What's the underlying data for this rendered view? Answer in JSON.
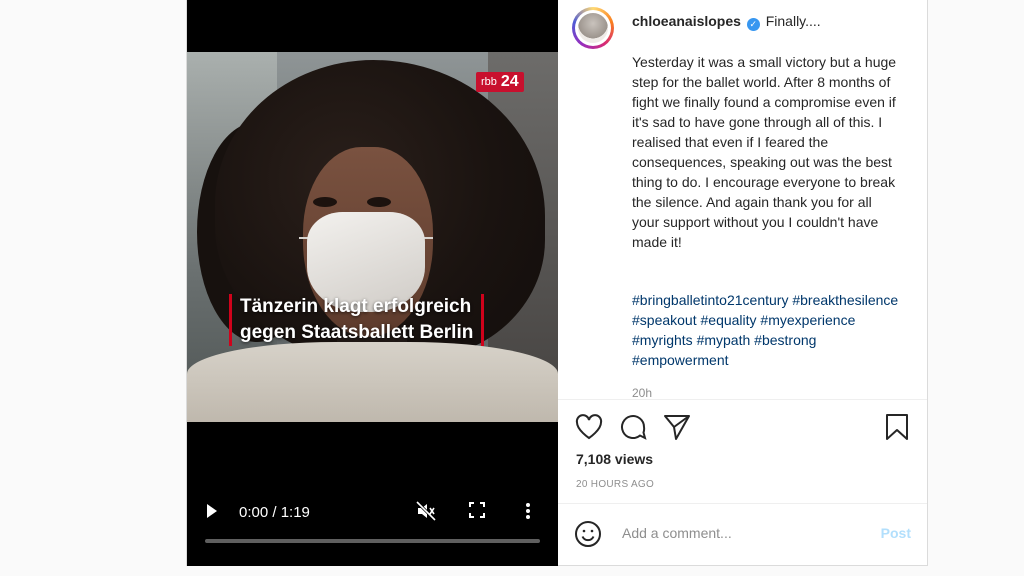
{
  "video": {
    "channel_logo_small": "rbb",
    "channel_logo_big": "24",
    "caption_line1": "Tänzerin klagt erfolgreich",
    "caption_line2": "gegen Staatsballett Berlin",
    "time": "0:00 / 1:19",
    "progress_fraction": 0.0,
    "icons": {
      "play": "play-icon",
      "mute": "muted-speaker-icon",
      "fullscreen": "fullscreen-icon",
      "more": "more-vertical-icon"
    }
  },
  "post": {
    "username": "chloeanaislopes",
    "verified_icon": "verified-badge-icon",
    "title": "Finally....",
    "caption": "Yesterday it was a small victory but a huge step for the ballet world. After 8 months of fight we finally found a compromise even if it's sad to have gone through all of this. I realised that even if I feared the consequences, speaking out was the best thing to do. I encourage everyone to break the silence. And again thank you for all your support without you I couldn't have made it!",
    "hashtags": "#bringballetinto21century #breakthesilence #speakout #equality #myexperience #myrights #mypath #bestrong #empowerment",
    "posted_relative": "20h"
  },
  "actions": {
    "icons": {
      "like": "heart-icon",
      "comment": "comment-bubble-icon",
      "share": "send-icon",
      "save": "bookmark-icon"
    },
    "views": "7,108 views",
    "time_ago": "20 HOURS AGO"
  },
  "comment": {
    "emoji_icon": "emoji-icon",
    "placeholder": "Add a comment...",
    "post_label": "Post"
  },
  "colors": {
    "link": "#00376b",
    "post_button_disabled": "#b2dffc",
    "verified": "#3897f0",
    "accent_red": "#c8102e"
  }
}
